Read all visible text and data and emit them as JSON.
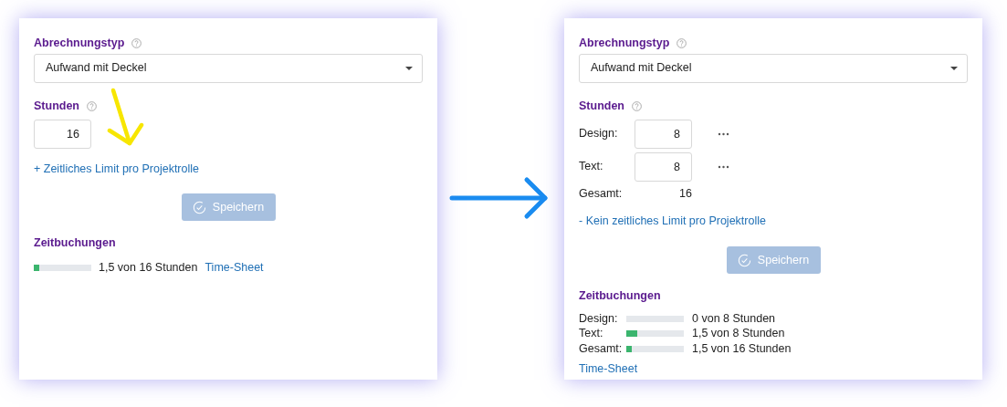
{
  "panels": [
    {
      "kind": "single",
      "marked": true,
      "billing_type": {
        "label": "Abrechnungstyp",
        "value": "Aufwand mit Deckel"
      },
      "hours": {
        "label": "Stunden",
        "rows": [
          {
            "kind": "input",
            "value": "16"
          }
        ]
      },
      "limit_link": "+ Zeitliches Limit pro Projektrolle",
      "save_button": {
        "label": "Speichern",
        "disabled": true
      },
      "bookings": {
        "title": "Zeitbuchungen",
        "rows": [
          {
            "level": 0.094,
            "text": "1,5 von 16 Stunden"
          }
        ],
        "timesheet_link": "Time-Sheet"
      }
    },
    {
      "kind": "per_role",
      "marked": false,
      "billing_type": {
        "label": "Abrechnungstyp",
        "value": "Aufwand mit Deckel"
      },
      "hours": {
        "label": "Stunden",
        "rows": [
          {
            "kind": "input",
            "label": "Design:",
            "value": "8"
          },
          {
            "kind": "input",
            "label": "Text:",
            "value": "8"
          },
          {
            "kind": "total",
            "label": "Gesamt:",
            "value": "16"
          }
        ]
      },
      "limit_link": "- Kein zeitliches Limit pro Projektrolle",
      "save_button": {
        "label": "Speichern",
        "disabled": true
      },
      "bookings": {
        "title": "Zeitbuchungen",
        "rows": [
          {
            "label": "Design:",
            "text": "0 von 8 Stunden"
          },
          {
            "label": "Text:",
            "level": 0.1875,
            "text": "1,5 von 8 Stunden"
          },
          {
            "label": "Gesamt:",
            "level": 0.094,
            "text": "1,5 von 16 Stunden"
          }
        ],
        "timesheet_link": "Time-Sheet"
      }
    }
  ]
}
